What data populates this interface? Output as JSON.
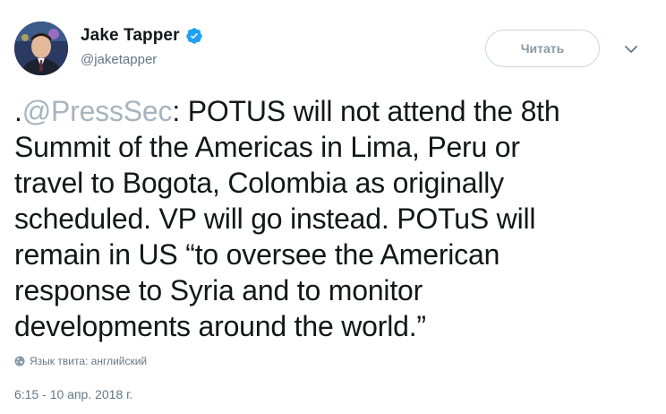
{
  "author": {
    "display_name": "Jake Tapper",
    "username": "@jaketapper",
    "verified": true,
    "avatar_icon": "profile-photo"
  },
  "follow_button": {
    "label": "Читать"
  },
  "menu_icon": "chevron-down-icon",
  "tweet": {
    "prefix": ".",
    "mention": "@PressSec",
    "line1_rest": ": POTUS will not attend the 8th",
    "line2": "Summit of the Americas in Lima, Peru or",
    "line3": "travel to Bogota, Colombia as originally",
    "line4": "scheduled. VP will go instead. POTuS will",
    "line5": "remain in US “to oversee the American",
    "line6": "response to Syria and to monitor",
    "line7": "developments around the world.”"
  },
  "language_note": "Язык твита: английский",
  "timestamp": "6:15 - 10 апр. 2018 г.",
  "colors": {
    "text": "#14171a",
    "secondary": "#657786",
    "mention": "#a7b4bf",
    "verified_badge": "#1da1f2",
    "button_border": "#ccd6dd"
  }
}
